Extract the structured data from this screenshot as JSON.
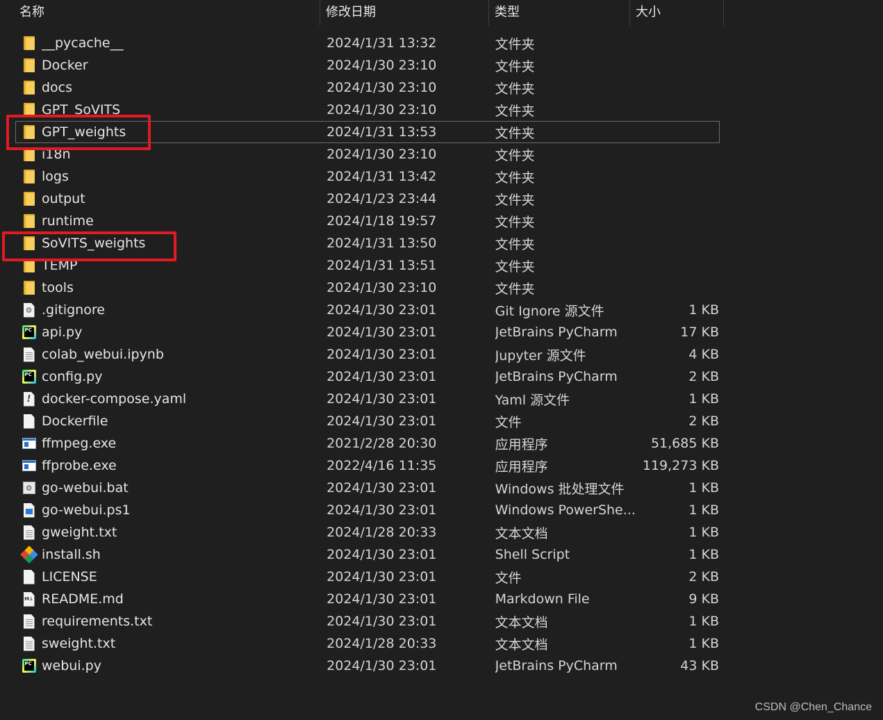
{
  "header": {
    "name": "名称",
    "date": "修改日期",
    "type": "类型",
    "size": "大小"
  },
  "rows": [
    {
      "name": "__pycache__",
      "date": "2024/1/31 13:32",
      "type": "文件夹",
      "size": "",
      "icon": "folder-icon"
    },
    {
      "name": "Docker",
      "date": "2024/1/30 23:10",
      "type": "文件夹",
      "size": "",
      "icon": "folder-icon"
    },
    {
      "name": "docs",
      "date": "2024/1/30 23:10",
      "type": "文件夹",
      "size": "",
      "icon": "folder-icon"
    },
    {
      "name": "GPT_SoVITS",
      "date": "2024/1/30 23:10",
      "type": "文件夹",
      "size": "",
      "icon": "folder-icon"
    },
    {
      "name": "GPT_weights",
      "date": "2024/1/31 13:53",
      "type": "文件夹",
      "size": "",
      "icon": "folder-icon",
      "selected": true
    },
    {
      "name": "i18n",
      "date": "2024/1/30 23:10",
      "type": "文件夹",
      "size": "",
      "icon": "folder-icon"
    },
    {
      "name": "logs",
      "date": "2024/1/31 13:42",
      "type": "文件夹",
      "size": "",
      "icon": "folder-icon"
    },
    {
      "name": "output",
      "date": "2024/1/23 23:44",
      "type": "文件夹",
      "size": "",
      "icon": "folder-icon"
    },
    {
      "name": "runtime",
      "date": "2024/1/18 19:57",
      "type": "文件夹",
      "size": "",
      "icon": "folder-icon"
    },
    {
      "name": "SoVITS_weights",
      "date": "2024/1/31 13:50",
      "type": "文件夹",
      "size": "",
      "icon": "folder-icon"
    },
    {
      "name": "TEMP",
      "date": "2024/1/31 13:51",
      "type": "文件夹",
      "size": "",
      "icon": "folder-icon"
    },
    {
      "name": "tools",
      "date": "2024/1/30 23:10",
      "type": "文件夹",
      "size": "",
      "icon": "folder-icon"
    },
    {
      "name": ".gitignore",
      "date": "2024/1/30 23:01",
      "type": "Git Ignore 源文件",
      "size": "1 KB",
      "icon": "gear-doc-icon"
    },
    {
      "name": "api.py",
      "date": "2024/1/30 23:01",
      "type": "JetBrains PyCharm",
      "size": "17 KB",
      "icon": "pycharm-icon"
    },
    {
      "name": "colab_webui.ipynb",
      "date": "2024/1/30 23:01",
      "type": "Jupyter 源文件",
      "size": "4 KB",
      "icon": "document-icon"
    },
    {
      "name": "config.py",
      "date": "2024/1/30 23:01",
      "type": "JetBrains PyCharm",
      "size": "2 KB",
      "icon": "pycharm-icon"
    },
    {
      "name": "docker-compose.yaml",
      "date": "2024/1/30 23:01",
      "type": "Yaml 源文件",
      "size": "1 KB",
      "icon": "yaml-icon"
    },
    {
      "name": "Dockerfile",
      "date": "2024/1/30 23:01",
      "type": "文件",
      "size": "2 KB",
      "icon": "blank-file-icon"
    },
    {
      "name": "ffmpeg.exe",
      "date": "2021/2/28 20:30",
      "type": "应用程序",
      "size": "51,685 KB",
      "icon": "exe-icon"
    },
    {
      "name": "ffprobe.exe",
      "date": "2022/4/16 11:35",
      "type": "应用程序",
      "size": "119,273 KB",
      "icon": "exe-icon"
    },
    {
      "name": "go-webui.bat",
      "date": "2024/1/30 23:01",
      "type": "Windows 批处理文件",
      "size": "1 KB",
      "icon": "bat-icon"
    },
    {
      "name": "go-webui.ps1",
      "date": "2024/1/30 23:01",
      "type": "Windows PowerShe...",
      "size": "1 KB",
      "icon": "ps1-icon"
    },
    {
      "name": "gweight.txt",
      "date": "2024/1/28 20:33",
      "type": "文本文档",
      "size": "1 KB",
      "icon": "text-file-icon"
    },
    {
      "name": "install.sh",
      "date": "2024/1/30 23:01",
      "type": "Shell Script",
      "size": "1 KB",
      "icon": "git-shell-icon"
    },
    {
      "name": "LICENSE",
      "date": "2024/1/30 23:01",
      "type": "文件",
      "size": "2 KB",
      "icon": "blank-file-icon"
    },
    {
      "name": "README.md",
      "date": "2024/1/30 23:01",
      "type": "Markdown File",
      "size": "9 KB",
      "icon": "markdown-icon"
    },
    {
      "name": "requirements.txt",
      "date": "2024/1/30 23:01",
      "type": "文本文档",
      "size": "1 KB",
      "icon": "text-file-icon"
    },
    {
      "name": "sweight.txt",
      "date": "2024/1/28 20:33",
      "type": "文本文档",
      "size": "1 KB",
      "icon": "text-file-icon"
    },
    {
      "name": "webui.py",
      "date": "2024/1/30 23:01",
      "type": "JetBrains PyCharm",
      "size": "43 KB",
      "icon": "pycharm-icon"
    }
  ],
  "watermark": "CSDN @Chen_Chance",
  "colors": {
    "background": "#1f1f1f",
    "highlight": "#e01b24",
    "folder": "#f7cf5c"
  }
}
